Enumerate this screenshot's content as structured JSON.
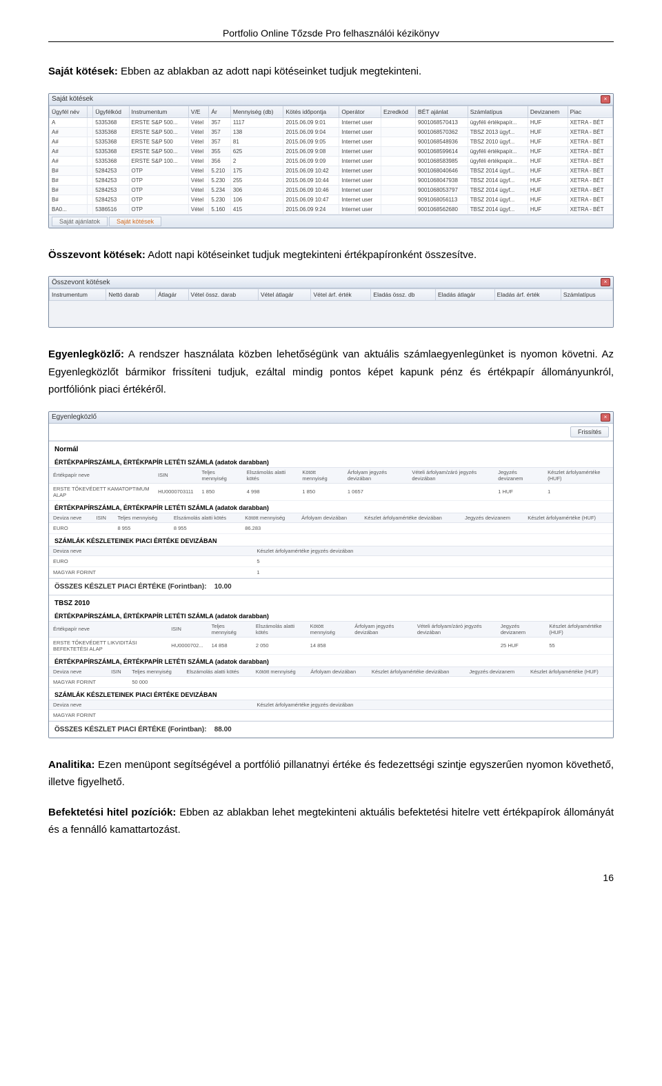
{
  "doc": {
    "header": "Portfolio Online Tőzsde Pro felhasználói kézikönyv",
    "page_number": "16"
  },
  "paragraphs": {
    "sajat_kotesek_bold": "Saját kötések:",
    "sajat_kotesek_text": " Ebben az ablakban az adott napi kötéseinket tudjuk megtekinteni.",
    "osszevont_bold": "Összevont kötések:",
    "osszevont_text": " Adott napi kötéseinket tudjuk megtekinteni értékpapíronként összesítve.",
    "egyenleg_bold": "Egyenlegközlő:",
    "egyenleg_text": " A rendszer használata közben lehetőségünk van aktuális számlaegyenlegünket is nyomon követni. Az Egyenlegközlőt bármikor frissíteni tudjuk, ezáltal mindig pontos képet kapunk pénz és értékpapír állományunkról, portfóliónk piaci értékéről.",
    "analitika_bold": "Analitika:",
    "analitika_text": " Ezen menüpont segítségével a portfólió pillanatnyi értéke és fedezettségi szintje egyszerűen nyomon követhető, illetve figyelhető.",
    "befhitel_bold": "Befektetési hitel pozíciók:",
    "befhitel_text": " Ebben az ablakban lehet megtekinteni aktuális befektetési hitelre vett értékpapírok állományát és a fennálló kamattartozást."
  },
  "sajat_kotesek_window": {
    "title": "Saját kötések",
    "tabs": {
      "active": "Saját kötések",
      "inactive": "Saját ajánlatok"
    },
    "headers": [
      "Ügyfél név",
      "",
      "Ügyfélkód",
      "Instrumentum",
      "V/E",
      "Ár",
      "Mennyiség (db)",
      "Kötés időpontja",
      "Operátor",
      "Ezredkód",
      "BÉT ajánlat",
      "Számlatípus",
      "Devizanem",
      "Piac"
    ],
    "rows": [
      [
        "A",
        "",
        "5335368",
        "ERSTE S&P 500...",
        "Vétel",
        "357",
        "1117",
        "2015.06.09 9:01",
        "Internet user",
        "",
        "9001068570413",
        "ügyféli értékpapír...",
        "HUF",
        "XETRA - BÉT"
      ],
      [
        "A#",
        "",
        "5335368",
        "ERSTE S&P 500...",
        "Vétel",
        "357",
        "138",
        "2015.06.09 9:04",
        "Internet user",
        "",
        "9001068570362",
        "TBSZ 2013 ügyf...",
        "HUF",
        "XETRA - BÉT"
      ],
      [
        "A#",
        "",
        "5335368",
        "ERSTE S&P 500",
        "Vétel",
        "357",
        "81",
        "2015.06.09 9:05",
        "Internet user",
        "",
        "9001068548936",
        "TBSZ 2010 ügyf...",
        "HUF",
        "XETRA - BÉT"
      ],
      [
        "A#",
        "",
        "5335368",
        "ERSTE S&P 500...",
        "Vétel",
        "355",
        "625",
        "2015.06.09 9:08",
        "Internet user",
        "",
        "9001068599614",
        "ügyféli értékpapír...",
        "HUF",
        "XETRA - BÉT"
      ],
      [
        "A#",
        "",
        "5335368",
        "ERSTE S&P 100...",
        "Vétel",
        "356",
        "2",
        "2015.06.09 9:09",
        "Internet user",
        "",
        "9001068583985",
        "ügyféli értékpapír...",
        "HUF",
        "XETRA - BÉT"
      ],
      [
        "B#",
        "",
        "5284253",
        "OTP",
        "Vétel",
        "5.210",
        "175",
        "2015.06.09 10:42",
        "Internet user",
        "",
        "9001068040646",
        "TBSZ 2014 ügyf...",
        "HUF",
        "XETRA - BÉT"
      ],
      [
        "B#",
        "",
        "5284253",
        "OTP",
        "Vétel",
        "5.230",
        "255",
        "2015.06.09 10:44",
        "Internet user",
        "",
        "9001068047938",
        "TBSZ 2014 ügyf...",
        "HUF",
        "XETRA - BÉT"
      ],
      [
        "B#",
        "",
        "5284253",
        "OTP",
        "Vétel",
        "5.234",
        "306",
        "2015.06.09 10:46",
        "Internet user",
        "",
        "9001068053797",
        "TBSZ 2014 ügyf...",
        "HUF",
        "XETRA - BÉT"
      ],
      [
        "B#",
        "",
        "5284253",
        "OTP",
        "Vétel",
        "5.230",
        "106",
        "2015.06.09 10:47",
        "Internet user",
        "",
        "9091068056113",
        "TBSZ 2014 ügyf...",
        "HUF",
        "XETRA - BÉT"
      ],
      [
        "BA0...",
        "",
        "5386516",
        "OTP",
        "Vétel",
        "5.160",
        "415",
        "2015.06.09 9:24",
        "Internet user",
        "",
        "9001068562680",
        "TBSZ 2014 ügyf...",
        "HUF",
        "XETRA - BÉT"
      ]
    ]
  },
  "osszevont_window": {
    "title": "Összevont kötések",
    "headers": [
      "Instrumentum",
      "Nettó darab",
      "Átlagár",
      "Vétel össz. darab",
      "Vétel átlagár",
      "Vétel árf. érték",
      "Eladás össz. db",
      "Eladás átlagár",
      "Eladás árf. érték",
      "Számlatípus"
    ]
  },
  "egyenleg_window": {
    "title": "Egyenlegközlő",
    "refresh": "Frissítés",
    "section_normal": "Normál",
    "tbsz_section": "TBSZ 2010",
    "groups": {
      "ertekpapir_db": "ÉRTÉKPAPÍRSZÁMLA, ÉRTÉKPAPÍR LETÉTI SZÁMLA (adatok darabban)",
      "szamlak_deviza": "SZÁMLÁK KÉSZLETEINEK PIACI ÉRTÉKE DEVIZÁBAN",
      "osszes_forint": "ÖSSZES KÉSZLET PIACI ÉRTÉKE (Forintban):",
      "osszes_forint_value_normal": "10.00",
      "osszes_forint_value_tbsz": "88.00"
    },
    "table1_headers": [
      "Értékpapír neve",
      "ISIN",
      "Teljes mennyiség",
      "Elszámolás alatti kötés",
      "Kötött mennyiség",
      "Árfolyam jegyzés devizában",
      "Vételi árfolyam/záró jegyzés devizában",
      "Jegyzés devizanem",
      "Készlet árfolyamértéke (HUF)"
    ],
    "table1_rows": [
      [
        "ERSTE TŐKEVÉDETT KAMATOPTIMUM ALAP",
        "HU0000703111",
        "1 850",
        "4 998",
        "1 850",
        "1 0657",
        "",
        "1 HUF",
        "1"
      ]
    ],
    "table2_headers": [
      "Deviza neve",
      "ISIN",
      "Teljes mennyiség",
      "Elszámolás alatti kötés",
      "Kötött mennyiség",
      "Árfolyam devizában",
      "Készlet árfolyamértéke devizában",
      "Jegyzés devizanem",
      "Készlet árfolyamértéke (HUF)"
    ],
    "table2_rows": [
      [
        "EURO",
        "",
        "8 955",
        "8 955",
        "86.283",
        "",
        "",
        "",
        ""
      ]
    ],
    "table3_headers": [
      "Deviza neve",
      "",
      "Készlet árfolyamértéke jegyzés devizában"
    ],
    "table3_rows": [
      [
        "EURO",
        "",
        "5"
      ],
      [
        "MAGYAR FORINT",
        "",
        "1"
      ]
    ],
    "tbsz_table1_rows": [
      [
        "ERSTE TŐKEVÉDETT LIKVIDITÁSI BEFEKTETÉSI ALAP",
        "HU0000702...",
        "14 858",
        "2 050",
        "14 858",
        "",
        "",
        "25 HUF",
        "55"
      ]
    ],
    "tbsz_table2_headers": [
      "Deviza neve",
      "ISIN",
      "Teljes mennyiség",
      "Elszámolás alatti kötés",
      "Kötött mennyiség",
      "Árfolyam devizában",
      "Készlet árfolyamértéke devizában",
      "Jegyzés devizanem",
      "Készlet árfolyamértéke (HUF)"
    ],
    "tbsz_table2_rows": [
      [
        "MAGYAR FORINT",
        "",
        "50 000",
        "",
        "",
        "",
        "",
        "",
        ""
      ]
    ],
    "tbsz_table3_rows": [
      [
        "MAGYAR FORINT",
        "",
        ""
      ]
    ]
  }
}
